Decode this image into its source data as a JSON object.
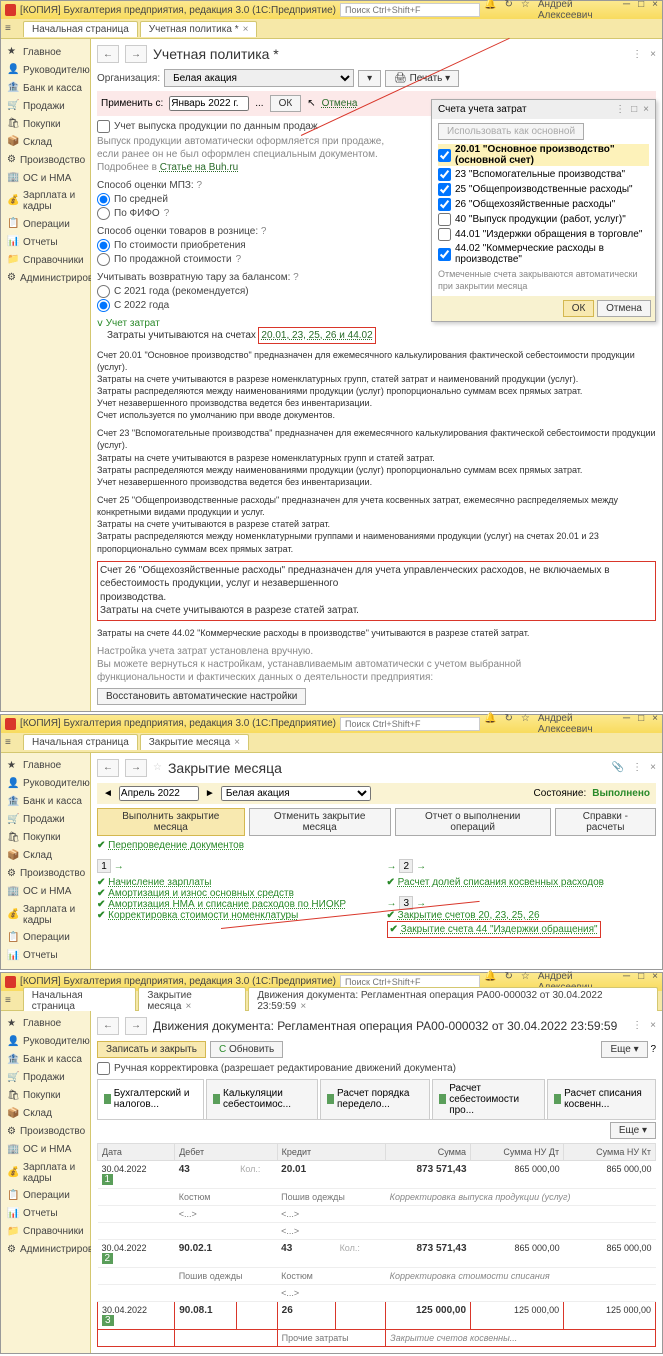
{
  "windows": [
    {
      "title": "[КОПИЯ] Бухгалтерия предприятия, редакция 3.0  (1С:Предприятие)",
      "search_placeholder": "Поиск Ctrl+Shift+F",
      "user": "Андрей Алексеевич",
      "tabs": [
        "Начальная страница",
        "Учетная политика *"
      ],
      "sidebar": [
        "Главное",
        "Руководителю",
        "Банк и касса",
        "Продажи",
        "Покупки",
        "Склад",
        "Производство",
        "ОС и НМА",
        "Зарплата и кадры",
        "Операции",
        "Отчеты",
        "Справочники",
        "Администрирование"
      ],
      "page": {
        "title": "Учетная политика *",
        "org_label": "Организация:",
        "org_value": "Белая акация",
        "print_label": "Печать",
        "apply_label": "Применить с:",
        "apply_value": "Январь 2022 г.",
        "ok": "ОК",
        "cancel": "Отмена",
        "chk_release": "Учет выпуска продукции по данным продаж",
        "gray1": "Выпуск продукции автоматически оформляется при продаже,",
        "gray2": "если ранее он не был оформлен специальным документом.",
        "gray3_prefix": "Подробнее в ",
        "gray3_link": "Статье на Buh.ru",
        "mpz_label": "Способ оценки МПЗ:",
        "mpz_opts": [
          "По средней",
          "По ФИФО"
        ],
        "retail_label": "Способ оценки товаров в рознице:",
        "retail_opts": [
          "По стоимости приобретения",
          "По продажной стоимости"
        ],
        "tara_label": "Учитывать возвратную тару за балансом:",
        "tara_opts": [
          "С 2021 года (рекомендуется)",
          "С 2022 года"
        ],
        "costs_header": "Учет затрат",
        "costs_line": "Затраты учитываются на счетах",
        "costs_accounts": "20.01, 23, 25, 26 и 44.02",
        "para1": "Счет 20.01 \"Основное производство\" предназначен для ежемесячного калькулирования фактической себестоимости продукции (услуг).\nЗатраты на счете учитываются в разрезе номенклатурных групп, статей затрат и наименований продукции (услуг).\nЗатраты распределяются между наименованиями продукции (услуг) пропорционально суммам всех прямых затрат.\nУчет незавершенного производства ведется без инвентаризации.\nСчет используется по умолчанию при вводе документов.",
        "para2": "Счет 23 \"Вспомогательные производства\" предназначен для ежемесячного калькулирования фактической себестоимости продукции (услуг).\nЗатраты на счете учитываются в разрезе номенклатурных групп и статей затрат.\nЗатраты распределяются между наименованиями продукции (услуг) пропорционально суммам всех прямых затрат.\nУчет незавершенного производства ведется без инвентаризации.",
        "para3": "Счет 25 \"Общепроизводственные расходы\" предназначен для учета косвенных затрат, ежемесячно распределяемых между конкретными видами продукции и услуг.\nЗатраты на счете учитываются в разрезе статей затрат.\nЗатраты распределяются между номенклатурными группами и наименованиями продукции (услуг) на счетах 20.01 и 23 пропорционально суммам всех прямых затрат.",
        "para4_l1": "Счет 26 \"Общехозяйственные расходы\" предназначен для учета управленческих расходов, не включаемых в себестоимость продукции, услуг и незавершенного",
        "para4_l2": "производства.",
        "para4_l3": "Затраты на счете учитываются в разрезе статей затрат.",
        "para5": "Затраты на счете 44.02 \"Коммерческие расходы в производстве\" учитываются в разрезе статей затрат.",
        "gray_footer1": "Настройка учета затрат установлена вручную.",
        "gray_footer2": "Вы можете вернуться к настройкам, устанавливаемым автоматически с учетом выбранной",
        "gray_footer3": "функциональности и фактических данных о деятельности предприятия:",
        "restore_btn": "Восстановить автоматические настройки"
      },
      "popup": {
        "title": "Счета учета затрат",
        "use_main": "Использовать как основной",
        "rows": [
          {
            "chk": true,
            "hl": true,
            "text": "20.01 \"Основное производство\" (основной счет)"
          },
          {
            "chk": true,
            "text": "23 \"Вспомогательные производства\""
          },
          {
            "chk": true,
            "text": "25 \"Общепроизводственные расходы\""
          },
          {
            "chk": true,
            "text": "26 \"Общехозяйственные расходы\""
          },
          {
            "chk": false,
            "text": "40 \"Выпуск продукции (работ, услуг)\""
          },
          {
            "chk": false,
            "text": "44.01 \"Издержки обращения в торговле\""
          },
          {
            "chk": true,
            "text": "44.02 \"Коммерческие расходы в производстве\""
          }
        ],
        "note": "Отмеченные счета закрываются автоматически при закрытии месяца",
        "ok": "ОК",
        "cancel": "Отмена"
      }
    },
    {
      "title": "[КОПИЯ] Бухгалтерия предприятия, редакция 3.0  (1С:Предприятие)",
      "search_placeholder": "Поиск Ctrl+Shift+F",
      "user": "Андрей Алексеевич",
      "tabs": [
        "Начальная страница",
        "Закрытие месяца"
      ],
      "sidebar": [
        "Главное",
        "Руководителю",
        "Банк и касса",
        "Продажи",
        "Покупки",
        "Склад",
        "Производство",
        "ОС и НМА",
        "Зарплата и кадры",
        "Операции",
        "Отчеты"
      ],
      "page": {
        "title": "Закрытие месяца",
        "period": "Апрель 2022",
        "org": "Белая акация",
        "status_label": "Состояние:",
        "status_value": "Выполнено",
        "btn_run": "Выполнить закрытие месяца",
        "btn_cancel": "Отменить закрытие месяца",
        "btn_report": "Отчет о выполнении операций",
        "btn_help": "Справки - расчеты",
        "reexec": "Перепроведение документов",
        "col1_num": "1",
        "col1_items": [
          "Начисление зарплаты",
          "Амортизация и износ основных средств",
          "Амортизация НМА и списание расходов по НИОКР",
          "Корректировка стоимости номенклатуры"
        ],
        "col2_num": "2",
        "col2_items": [
          "Расчет долей списания косвенных расходов"
        ],
        "col3_num": "3",
        "col3_items": [
          "Закрытие счетов 20, 23, 25, 26",
          "Закрытие счета 44 \"Издержки обращения\""
        ]
      }
    },
    {
      "title": "[КОПИЯ] Бухгалтерия предприятия, редакция 3.0  (1С:Предприятие)",
      "search_placeholder": "Поиск Ctrl+Shift+F",
      "user": "Андрей Алексеевич",
      "tabs": [
        "Начальная страница",
        "Закрытие месяца",
        "Движения документа: Регламентная операция РА00-000032 от 30.04.2022 23:59:59"
      ],
      "sidebar": [
        "Главное",
        "Руководителю",
        "Банк и касса",
        "Продажи",
        "Покупки",
        "Склад",
        "Производство",
        "ОС и НМА",
        "Зарплата и кадры",
        "Операции",
        "Отчеты",
        "Справочники",
        "Администрирование"
      ],
      "page": {
        "title": "Движения документа: Регламентная операция РА00-000032 от 30.04.2022 23:59:59",
        "btn_save": "Записать и закрыть",
        "btn_refresh": "Обновить",
        "btn_more": "Еще",
        "chk_manual": "Ручная корректировка (разрешает редактирование движений документа)",
        "subtabs": [
          "Бухгалтерский и налогов...",
          "Калькуляции себестоимос...",
          "Расчет порядка передело...",
          "Расчет себестоимости про...",
          "Расчет списания косвенн..."
        ],
        "more2": "Еще",
        "thead": [
          "Дата",
          "Дебет",
          "",
          "Кредит",
          "",
          "Сумма",
          "Сумма НУ Дт",
          "Сумма НУ Кт"
        ],
        "rows": [
          {
            "date": "30.04.2022",
            "n": "1",
            "dt": "43",
            "dtk": "Кол.:",
            "kt": "20.01",
            "sum": "873 571,43",
            "sd": "865 000,00",
            "sk": "865 000,00"
          },
          {
            "sub": true,
            "dt": "Костюм",
            "kt": "Пошив одежды",
            "note": "Корректировка выпуска продукции (услуг)"
          },
          {
            "sub": true,
            "dt": "<...>",
            "kt": "<...>"
          },
          {
            "sub": true,
            "dt": "",
            "kt": "<...>"
          },
          {
            "date": "30.04.2022",
            "n": "2",
            "dt": "90.02.1",
            "kt": "43",
            "ktk": "Кол.:",
            "sum": "873 571,43",
            "sd": "865 000,00",
            "sk": "865 000,00"
          },
          {
            "sub": true,
            "dt": "Пошив одежды",
            "kt": "Костюм",
            "note": "Корректировка стоимости списания"
          },
          {
            "sub": true,
            "dt": "",
            "kt": "<...>"
          },
          {
            "hl": true,
            "date": "30.04.2022",
            "n": "3",
            "dt": "90.08.1",
            "kt": "26",
            "sum": "125 000,00",
            "sd": "125 000,00",
            "sk": "125 000,00"
          },
          {
            "hl": true,
            "sub": true,
            "dt": "",
            "kt": "Прочие затраты",
            "note": "Закрытие счетов косвенны..."
          }
        ]
      }
    }
  ]
}
